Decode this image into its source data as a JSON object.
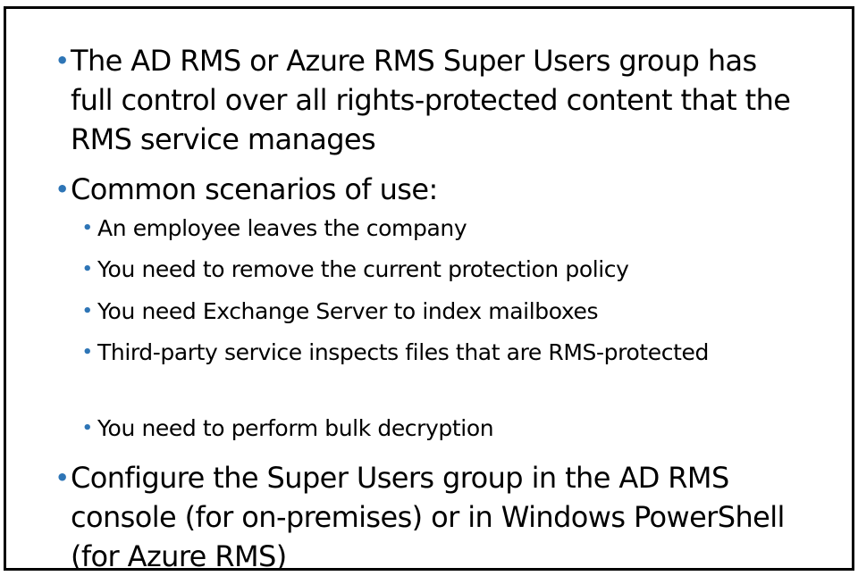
{
  "colors": {
    "bullet": "#2e75b6",
    "border": "#000000",
    "text": "#000000"
  },
  "bullets": [
    {
      "level": 1,
      "text": "The AD RMS or Azure RMS Super Users group has full control over all rights-protected content that the RMS service manages"
    },
    {
      "level": 1,
      "text": "Common scenarios of use:"
    },
    {
      "level": 2,
      "text": "An employee leaves the company"
    },
    {
      "level": 2,
      "text": "You need to remove the current protection policy"
    },
    {
      "level": 2,
      "text": "You need Exchange Server to index mailboxes"
    },
    {
      "level": 2,
      "text": "Third-party service inspects files that are RMS-protected"
    },
    {
      "level": 2,
      "text": "You need to perform bulk decryption"
    },
    {
      "level": 1,
      "text": "Configure the Super Users group in the AD RMS console (for on-premises) or in Windows PowerShell (for Azure RMS)"
    }
  ]
}
